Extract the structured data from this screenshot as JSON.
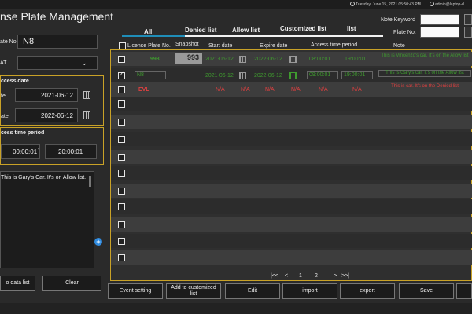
{
  "statusbar": {
    "clock": "Tuesday, June 15, 2021 05:50:43 PM",
    "user": "admin@laptop-d"
  },
  "title": "nse Plate Management",
  "left": {
    "plate_label": "ate No.",
    "plate_value": "N8",
    "cat_label": "AT.",
    "access_date_title": "ccess date",
    "start_label": "te",
    "start_value": "2021-06-12",
    "end_label": "ate",
    "end_value": "2022-06-12",
    "time_title": "cess time period",
    "time_from": "00:00:01",
    "time_sep": "-",
    "time_to": "20:00:01",
    "note": "This is Gary's Car. It's on Allow list.",
    "add_btn": "o data list",
    "clear_btn": "Clear"
  },
  "tabs": {
    "all": "All",
    "denied": "Denied list",
    "allow": "Allow list",
    "custom_line1": "Customized list",
    "custom_line2": "list"
  },
  "filter": {
    "note_keyword_label": "Note Keyword",
    "plate_label": "Plate No."
  },
  "columns": [
    "License Plate No.",
    "Snapshot",
    "Start date",
    "Expire date",
    "Access time period",
    "Note"
  ],
  "rows": [
    {
      "plate": "993",
      "snapshot": "993",
      "start": "2021-06-12",
      "expire": "2022-06-12",
      "t1": "08:00:01",
      "t2": "19:00:01",
      "note": "This is Vincenzo's car. It's on the Allow list",
      "color": "green",
      "checked": false
    },
    {
      "plate": "N8",
      "snapshot": "",
      "start": "2021-06-12",
      "expire": "2022-06-12",
      "t1": "09:00:01",
      "t2": "19:00:01",
      "note": "This is Gary's car. It's on the Allow list",
      "color": "green",
      "checked": true
    },
    {
      "plate": "EVL",
      "snapshot": "",
      "start": "N/A",
      "expire": "N/A",
      "t1": "N/A",
      "t2": "N/A",
      "note": "This is        car. It's on the Denied list",
      "color": "red",
      "checked": false
    }
  ],
  "pagination": {
    "first": "|<<",
    "prev": "<",
    "p1": "1",
    "p2": "2",
    "next": ">",
    "last": ">>|"
  },
  "actions": {
    "event": "Event setting",
    "add_custom": "Add to customized list",
    "edit": "Edit",
    "import": "import",
    "export": "export",
    "save": "Save"
  }
}
